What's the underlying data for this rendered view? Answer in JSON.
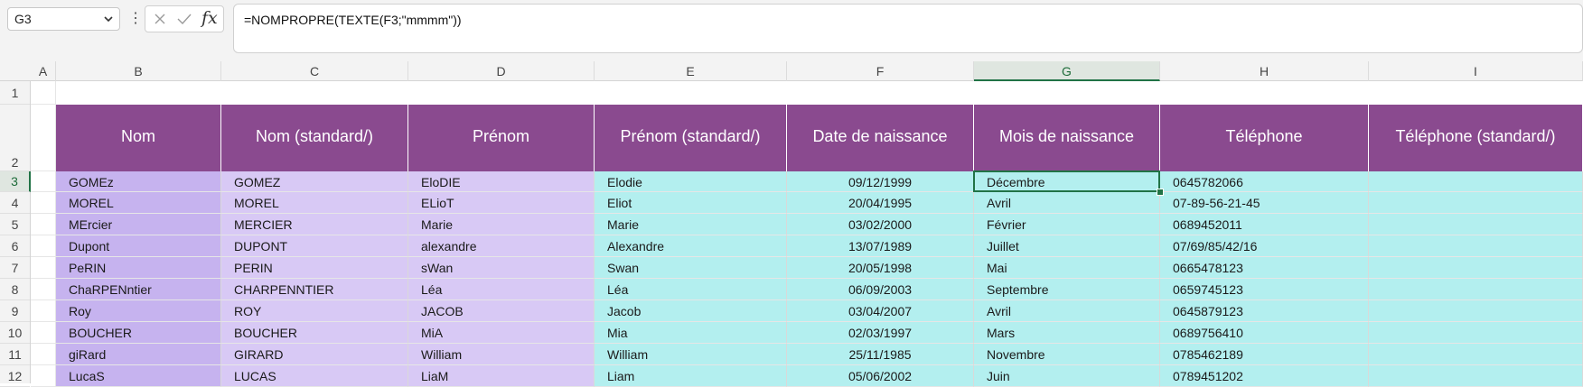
{
  "formula_bar": {
    "name_box": "G3",
    "formula": "=NOMPROPRE(TEXTE(F3;\"mmmm\"))",
    "fx_label": "fx"
  },
  "columns": [
    "A",
    "B",
    "C",
    "D",
    "E",
    "F",
    "G",
    "H",
    "I"
  ],
  "selected_column": "G",
  "row_numbers": [
    "1",
    "2",
    "3",
    "4",
    "5",
    "6",
    "7",
    "8",
    "9",
    "10",
    "11",
    "12"
  ],
  "selected_row": "3",
  "headers": [
    "Nom",
    "Nom (standard/)",
    "Prénom",
    "Prénom (standard/)",
    "Date de naissance",
    "Mois de naissance",
    "Téléphone",
    "Téléphone (standard/)"
  ],
  "rows": [
    [
      "GOMEz",
      "GOMEZ",
      "EloDIE",
      "Elodie",
      "09/12/1999",
      "Décembre",
      "0645782066",
      ""
    ],
    [
      "MOREL",
      "MOREL",
      "ELioT",
      "Eliot",
      "20/04/1995",
      "Avril",
      "07-89-56-21-45",
      ""
    ],
    [
      "MErcier",
      "MERCIER",
      "Marie",
      "Marie",
      "03/02/2000",
      "Février",
      "0689452011",
      ""
    ],
    [
      "Dupont",
      "DUPONT",
      "alexandre",
      "Alexandre",
      "13/07/1989",
      "Juillet",
      "07/69/85/42/16",
      ""
    ],
    [
      "PeRIN",
      "PERIN",
      "sWan",
      "Swan",
      "20/05/1998",
      "Mai",
      "0665478123",
      ""
    ],
    [
      "ChaRPENntier",
      "CHARPENNTIER",
      "Léa",
      "Léa",
      "06/09/2003",
      "Septembre",
      "0659745123",
      ""
    ],
    [
      "Roy",
      "ROY",
      "JACOB",
      "Jacob",
      "03/04/2007",
      "Avril",
      "0645879123",
      ""
    ],
    [
      "BOUCHER",
      "BOUCHER",
      "MiA",
      "Mia",
      "02/03/1997",
      "Mars",
      "0689756410",
      ""
    ],
    [
      "giRard",
      "GIRARD",
      "William",
      "William",
      "25/11/1985",
      "Novembre",
      "0785462189",
      ""
    ],
    [
      "LucaS",
      "LUCAS",
      "LiaM",
      "Liam",
      "05/06/2002",
      "Juin",
      "0789451202",
      ""
    ]
  ],
  "colors": {
    "header_fill": "#8a4a8f",
    "lavender_fill": "#d8c9f5",
    "cyan_fill": "#b3efef",
    "selection": "#217346"
  }
}
